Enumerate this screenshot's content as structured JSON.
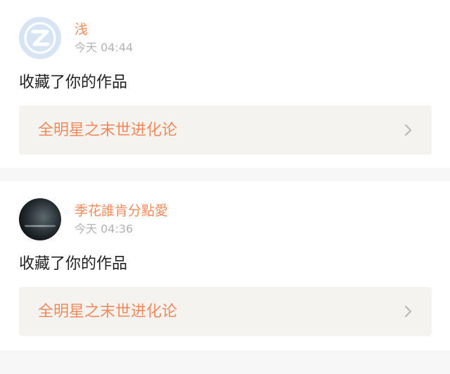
{
  "colors": {
    "accent": "#f08a5d",
    "card_background": "#ffffff",
    "divider_background": "#f7f7f7",
    "work_box_background": "#f4f3ef",
    "time_text": "#b3b3b3",
    "body_text": "#222222"
  },
  "notifications": [
    {
      "user_name": "浅",
      "time": "今天 04:44",
      "action_text": "收藏了你的作品",
      "work_title": "全明星之末世进化论",
      "avatar": "default-q-avatar"
    },
    {
      "user_name": "季花誰肯分點愛",
      "time": "今天 04:36",
      "action_text": "收藏了你的作品",
      "work_title": "全明星之末世进化论",
      "avatar": "user-photo-avatar"
    }
  ]
}
